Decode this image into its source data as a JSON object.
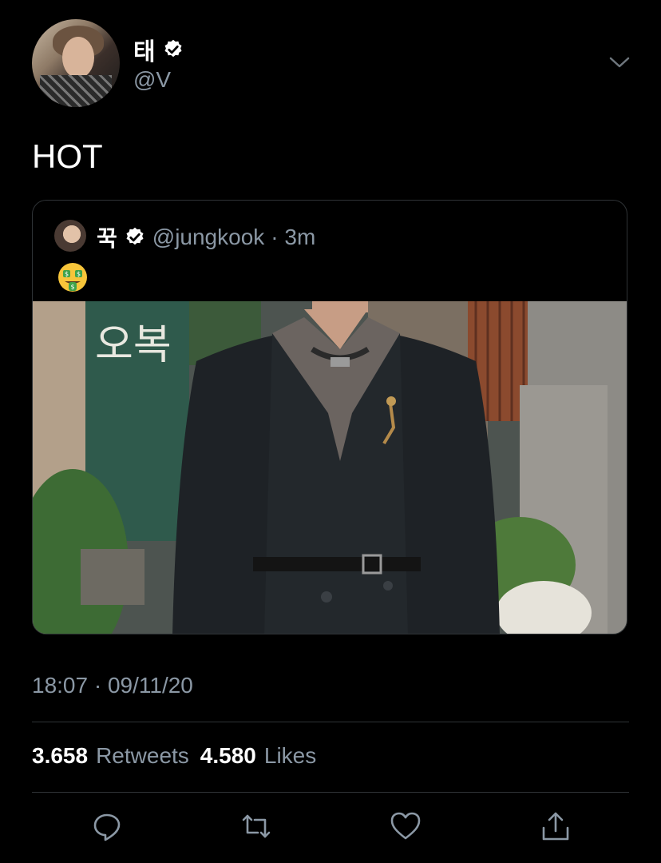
{
  "author": {
    "name": "태",
    "handle": "@V"
  },
  "tweet": {
    "text": "HOT"
  },
  "quoted": {
    "name": "꾹",
    "handle": "@jungkook",
    "age": "· 3m",
    "emoji": "money-mouth-face-emoji",
    "photo": {
      "sign_text": "오복"
    }
  },
  "timestamp": "18:07 · 09/11/20",
  "stats": {
    "retweets_count": "3.658",
    "retweets_label": "Retweets",
    "likes_count": "4.580",
    "likes_label": "Likes"
  },
  "icons": {
    "verified": "verified-badge-icon",
    "more": "chevron-down-icon",
    "reply": "reply-icon",
    "retweet": "retweet-icon",
    "like": "heart-icon",
    "share": "share-icon"
  },
  "colors": {
    "background": "#000000",
    "secondary_text": "#8b98a5",
    "divider": "#2f3336"
  }
}
